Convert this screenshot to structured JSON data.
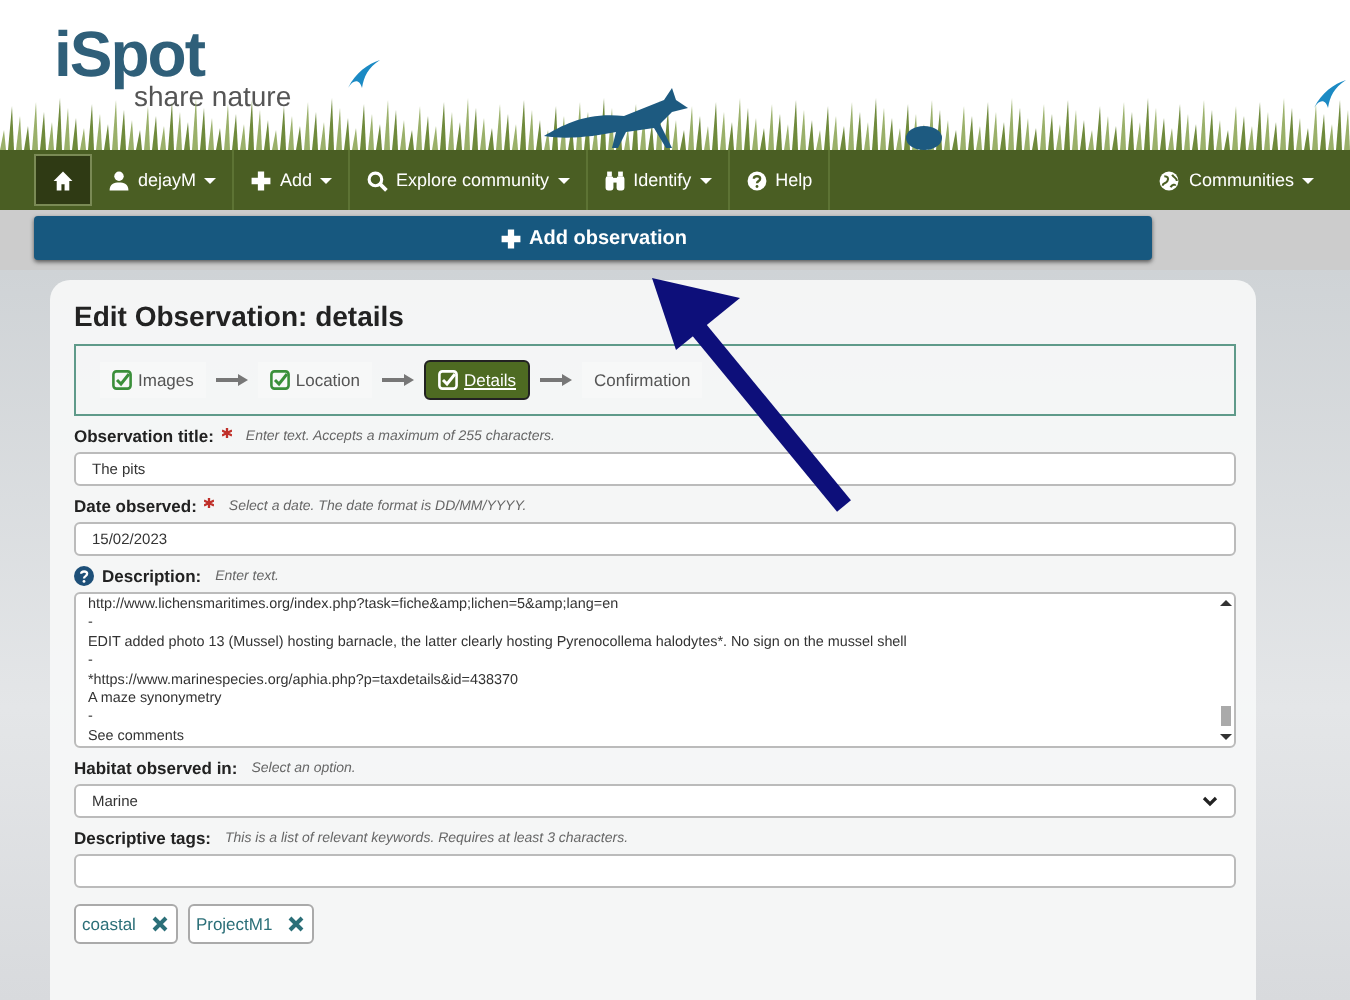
{
  "logo": {
    "name": "iSpot",
    "tagline": "share nature"
  },
  "nav": {
    "items": [
      {
        "kind": "home",
        "dropdown": false,
        "selected": true
      },
      {
        "kind": "user",
        "label": "dejayM",
        "dropdown": true,
        "selected": false
      },
      {
        "kind": "plus",
        "label": "Add",
        "dropdown": true,
        "selected": false
      },
      {
        "kind": "search",
        "label": "Explore community",
        "dropdown": true,
        "selected": false
      },
      {
        "kind": "binoculars",
        "label": "Identify",
        "dropdown": true,
        "selected": false
      },
      {
        "kind": "help",
        "label": "Help",
        "dropdown": false,
        "selected": false
      }
    ],
    "right": {
      "kind": "globe",
      "label": "Communities",
      "dropdown": true
    }
  },
  "add_button": "Add observation",
  "page_title": "Edit Observation: details",
  "steps": [
    {
      "label": "Images",
      "done": true,
      "selected": false
    },
    {
      "label": "Location",
      "done": true,
      "selected": false
    },
    {
      "label": "Details",
      "done": true,
      "selected": true
    },
    {
      "label": "Confirmation",
      "done": false,
      "selected": false
    }
  ],
  "fields": [
    {
      "kind": "text",
      "label": "Observation title:",
      "required": true,
      "hint": "Enter text. Accepts a maximum of 255 characters.",
      "value": "The pits"
    },
    {
      "kind": "text",
      "label": "Date observed:",
      "required": true,
      "hint": "Select a date. The date format is DD/MM/YYYY.",
      "value": "15/02/2023"
    },
    {
      "kind": "textarea",
      "label": "Description:",
      "help_icon": true,
      "required": false,
      "hint": "Enter text.",
      "lines": [
        "http://www.lichensmaritimes.org/index.php?task=fiche&amp;lichen=5&amp;lang=en",
        "-",
        "EDIT added photo 13 (Mussel) hosting barnacle, the latter clearly hosting Pyrenocollema halodytes*. No sign on the mussel shell",
        "-",
        "*https://www.marinespecies.org/aphia.php?p=taxdetails&id=438370",
        "A maze synonymetry",
        "-",
        "See comments"
      ]
    },
    {
      "kind": "select",
      "label": "Habitat observed in:",
      "required": false,
      "hint": "Select an option.",
      "value": "Marine"
    },
    {
      "kind": "tags",
      "label": "Descriptive tags:",
      "required": false,
      "hint": "This is a list of relevant keywords. Requires at least 3 characters.",
      "tags": [
        "coastal",
        "ProjectM1"
      ]
    }
  ]
}
